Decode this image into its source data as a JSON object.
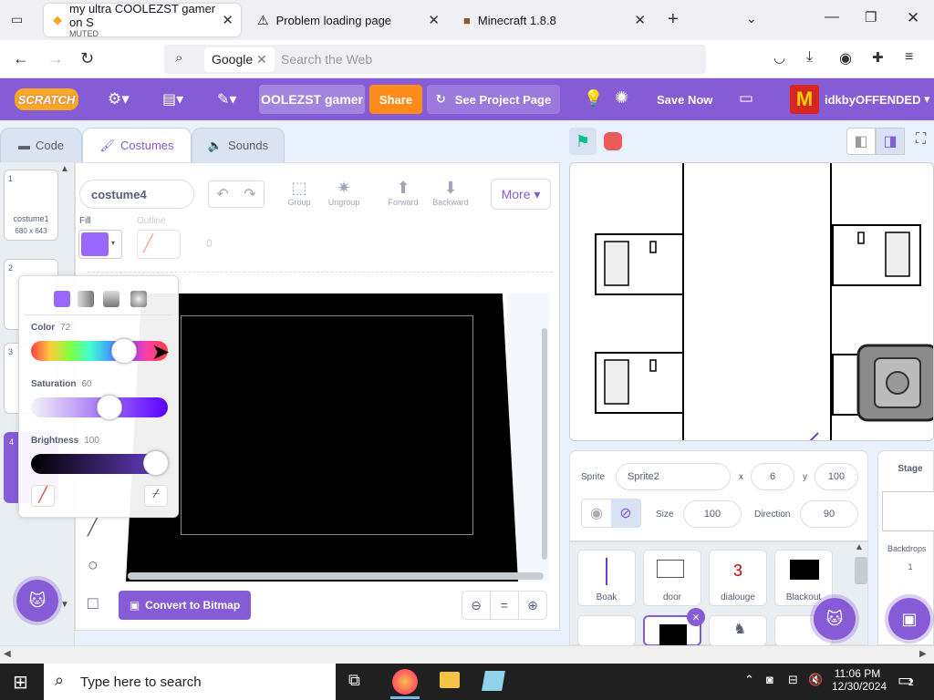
{
  "browser": {
    "tabs": [
      {
        "title": "my ultra COOLEZST gamer on S",
        "sub": "MUTED"
      },
      {
        "title": "Problem loading page"
      },
      {
        "title": "Minecraft 1.8.8"
      }
    ],
    "search_engine": "Google",
    "search_placeholder": "Search the Web"
  },
  "menubar": {
    "logo": "SCRATCH",
    "project_title": "OOLEZST gamer",
    "share": "Share",
    "see_project": "See Project Page",
    "save_now": "Save Now",
    "username": "idkbyOFFENDED"
  },
  "editor_tabs": {
    "code": "Code",
    "costumes": "Costumes",
    "sounds": "Sounds"
  },
  "costumes": [
    {
      "index": "1",
      "name": "costume1",
      "size": "680 x 643"
    },
    {
      "index": "2"
    },
    {
      "index": "3"
    },
    {
      "index": "4"
    }
  ],
  "paint": {
    "costume_name": "costume4",
    "fill_label": "Fill",
    "outline_label": "Outline",
    "outline_width": "0",
    "group": "Group",
    "ungroup": "Ungroup",
    "forward": "Forward",
    "backward": "Backward",
    "more": "More",
    "convert": "Convert to Bitmap",
    "fill_color": "#9966ff"
  },
  "picker": {
    "color_label": "Color",
    "color_value": "72",
    "saturation_label": "Saturation",
    "saturation_value": "60",
    "brightness_label": "Brightness",
    "brightness_value": "100"
  },
  "sprite": {
    "label": "Sprite",
    "name": "Sprite2",
    "x_label": "x",
    "x": "6",
    "y_label": "y",
    "y": "100",
    "size_label": "Size",
    "size": "100",
    "direction_label": "Direction",
    "direction": "90"
  },
  "sprites": [
    "Boak",
    "door",
    "dialouge",
    "Blackout"
  ],
  "dialouge_glyph": "3",
  "stage_panel": {
    "title": "Stage",
    "backdrops": "Backdrops",
    "count": "1"
  },
  "taskbar": {
    "search": "Type here to search",
    "time": "11:06 PM",
    "date": "12/30/2024",
    "notif": "2"
  }
}
